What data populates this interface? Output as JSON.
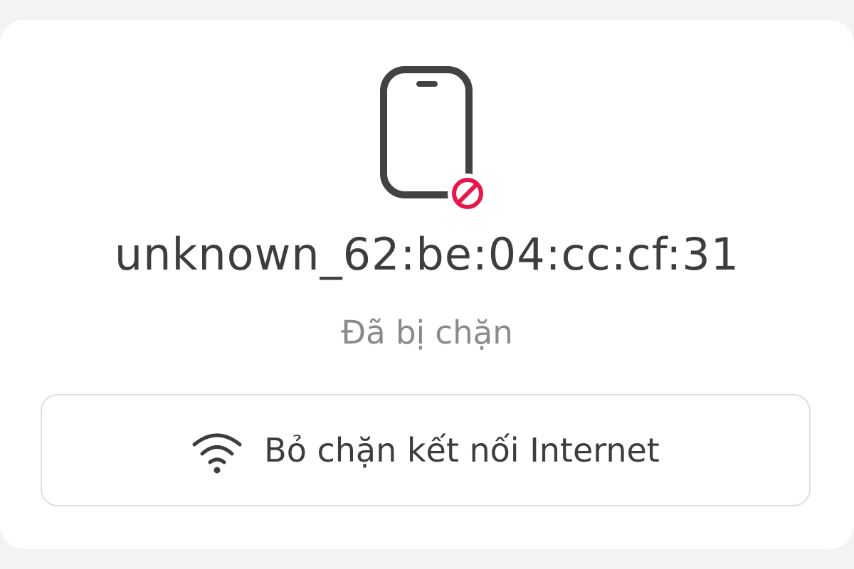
{
  "device": {
    "name": "unknown_62:be:04:cc:cf:31",
    "status": "Đã bị chặn",
    "icon": "smartphone-icon",
    "badge_icon": "blocked-icon"
  },
  "action": {
    "label": "Bỏ chặn kết nối Internet",
    "icon": "wifi-icon"
  },
  "colors": {
    "blocked_badge": "#e8174a",
    "icon_stroke": "#424242",
    "status_text": "#8a8a8a",
    "primary_text": "#3d3d3d"
  }
}
